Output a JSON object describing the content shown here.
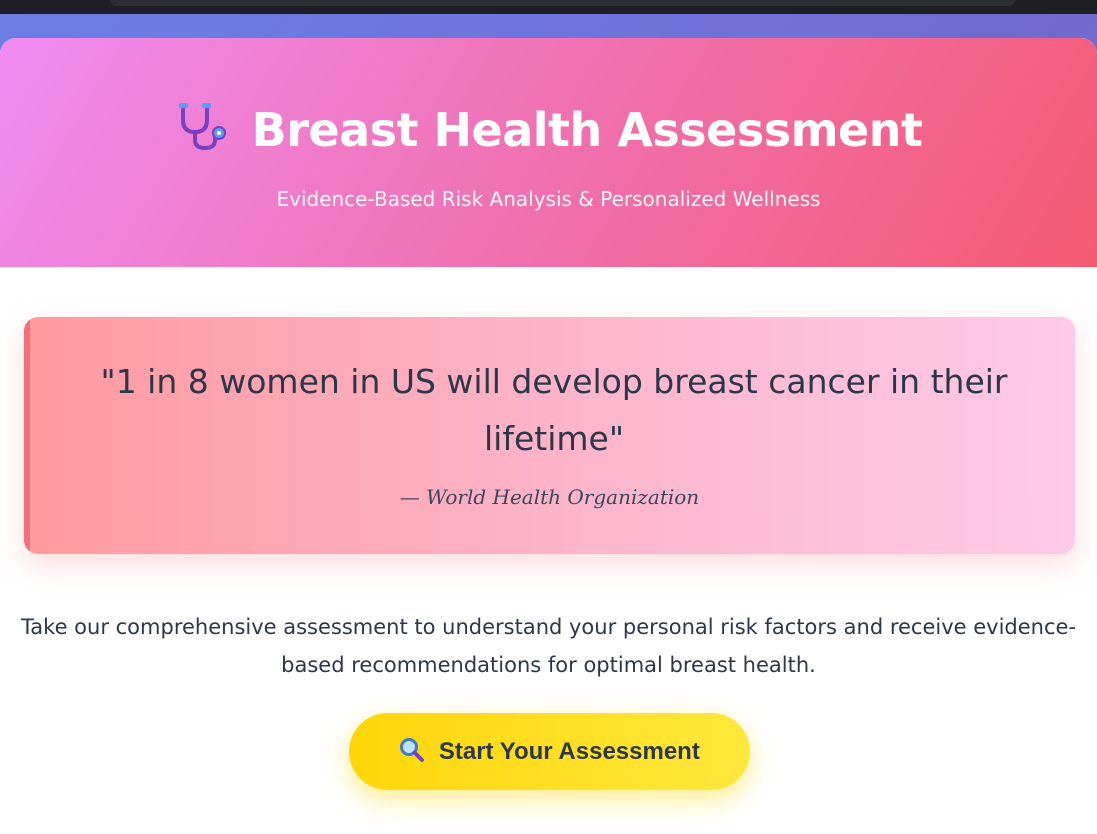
{
  "hero": {
    "icon": "stethoscope-icon",
    "title": "Breast Health Assessment",
    "subtitle": "Evidence-Based Risk Analysis & Personalized Wellness"
  },
  "quote": {
    "text": "\"1 in 8 women in US will develop breast cancer in their lifetime\"",
    "source": "— World Health Organization"
  },
  "intro": {
    "text": "Take our comprehensive assessment to understand your personal risk factors and receive evidence-based recommendations for optimal breast health."
  },
  "cta": {
    "icon": "magnifier-icon",
    "label": "Start Your Assessment"
  },
  "colors": {
    "page_background": "#6a7ee6",
    "hero_gradient_start": "#f08cf2",
    "hero_gradient_end": "#f55a72",
    "quote_gradient_start": "#ff9a9e",
    "quote_gradient_end": "#fecae8",
    "button": "#ffd60a",
    "text": "#2d3748"
  }
}
